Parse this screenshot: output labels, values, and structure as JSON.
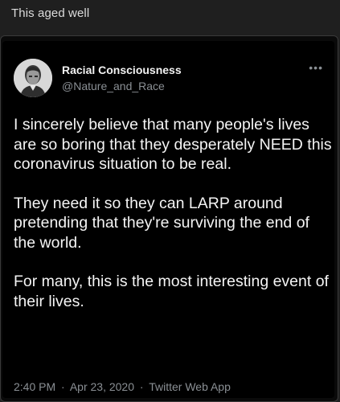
{
  "post": {
    "title": "This aged well"
  },
  "tweet": {
    "display_name": "Racial Consciousness",
    "handle": "@Nature_and_Race",
    "more_icon": "more-options-icon",
    "paragraphs": [
      "I sincerely believe that many people's lives are so boring that they desperately NEED this coronavirus situation to be real.",
      "They need it so they can LARP around pretending that they're surviving the end of the world.",
      "For many, this is the most interesting event of their lives."
    ],
    "time": "2:40 PM",
    "separator": "·",
    "date": "Apr 23, 2020",
    "source": "Twitter Web App"
  }
}
